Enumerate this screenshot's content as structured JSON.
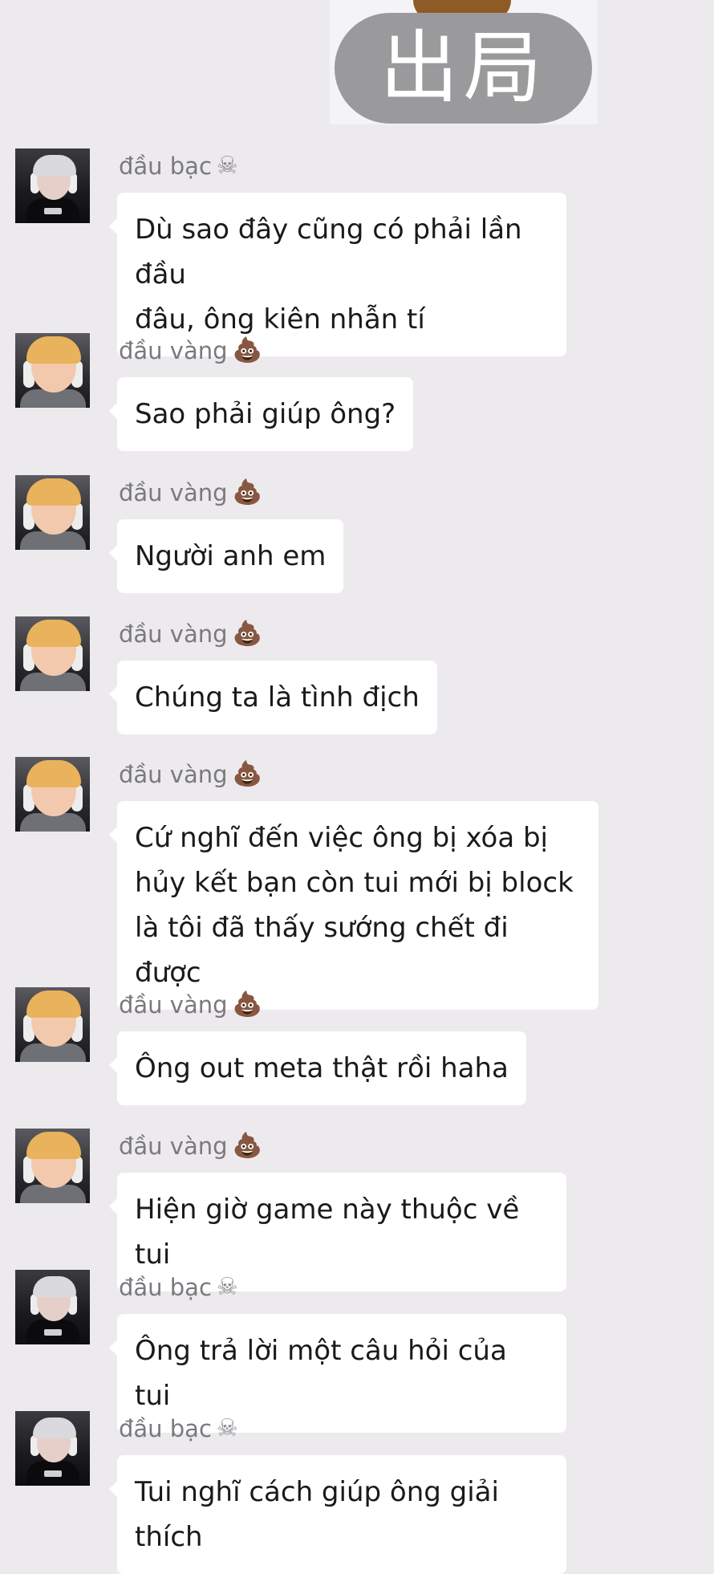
{
  "sticker": {
    "text": "出局"
  },
  "messages": [
    {
      "sender": "đầu bạc",
      "emoji": "☠",
      "emoji_name": "skull-crossbones-icon",
      "lines": [
        "Dù sao đây cũng có phải lần đầu",
        "đâu, ông kiên nhẫn tí"
      ]
    },
    {
      "sender": "đầu vàng",
      "emoji": "💩",
      "emoji_name": "pile-of-poo-icon",
      "lines": [
        "Sao phải giúp ông?"
      ]
    },
    {
      "sender": "đầu vàng",
      "emoji": "💩",
      "emoji_name": "pile-of-poo-icon",
      "lines": [
        "Người anh em"
      ]
    },
    {
      "sender": "đầu vàng",
      "emoji": "💩",
      "emoji_name": "pile-of-poo-icon",
      "lines": [
        "Chúng ta là tình địch"
      ]
    },
    {
      "sender": "đầu vàng",
      "emoji": "💩",
      "emoji_name": "pile-of-poo-icon",
      "lines": [
        "Cứ nghĩ đến việc ông bị xóa bị",
        "hủy kết bạn còn tui mới bị block",
        "là tôi đã thấy sướng chết đi được"
      ]
    },
    {
      "sender": "đầu vàng",
      "emoji": "💩",
      "emoji_name": "pile-of-poo-icon",
      "lines": [
        "Ông out meta thật rồi haha"
      ]
    },
    {
      "sender": "đầu vàng",
      "emoji": "💩",
      "emoji_name": "pile-of-poo-icon",
      "lines": [
        "Hiện giờ game này thuộc về tui"
      ]
    },
    {
      "sender": "đầu bạc",
      "emoji": "☠",
      "emoji_name": "skull-crossbones-icon",
      "lines": [
        "Ông trả lời một câu hỏi của tui"
      ]
    },
    {
      "sender": "đầu bạc",
      "emoji": "☠",
      "emoji_name": "skull-crossbones-icon",
      "lines": [
        "Tui nghĩ cách giúp ông giải thích"
      ]
    }
  ],
  "colors": {
    "background": "#EDEAEE",
    "bubble": "#FFFFFF",
    "sender_name": "#7A7A7E",
    "message_text": "#1A1A1A"
  }
}
